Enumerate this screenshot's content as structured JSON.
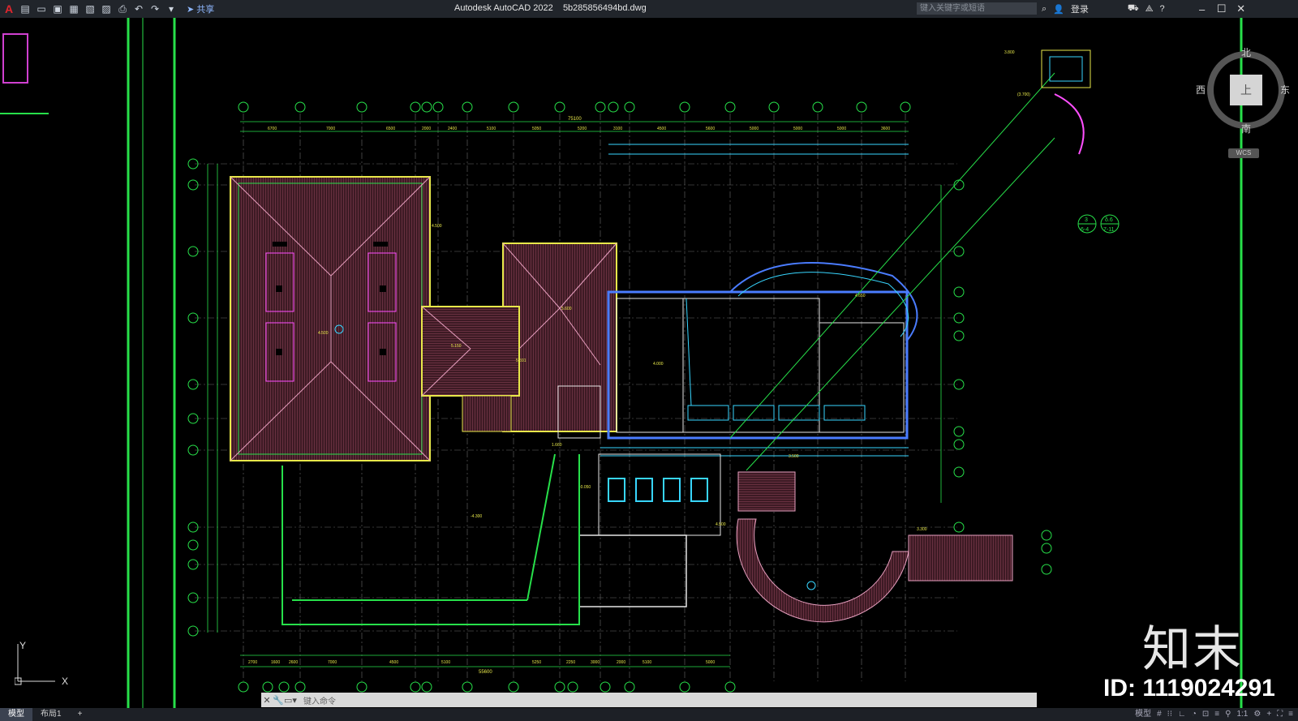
{
  "titlebar": {
    "app_name": "Autodesk AutoCAD 2022",
    "file_name": "5b285856494bd.dwg",
    "share_label": "共享",
    "search_placeholder": "键入关键字或短语",
    "login_label": "登录"
  },
  "viewcube": {
    "north": "北",
    "south": "南",
    "west": "西",
    "east": "东",
    "face": "上",
    "wcs": "WCS"
  },
  "commandline": {
    "placeholder": "键入命令"
  },
  "statusbar": {
    "tabs": [
      "模型",
      "布局1"
    ],
    "add_tab": "+",
    "right_model": "模型",
    "scale": "1:1"
  },
  "drawing": {
    "levels": [
      "4.500",
      "5.600",
      "5.150",
      "5.591",
      "4.000",
      "4.500",
      "-0.050",
      "-4.300",
      "1.660",
      "3.500",
      "4.500",
      "3.800",
      "(3.700)",
      "4.650",
      "3.300"
    ],
    "dims_top": [
      "6700",
      "7000",
      "6500",
      "2000",
      "2400",
      "5100",
      "5050",
      "5200",
      "3100",
      "4500",
      "5600",
      "5000",
      "5000",
      "5000",
      "3600"
    ],
    "total_top": "75100",
    "dims_bottom": [
      "2700",
      "1600",
      "2600",
      "7000",
      "4500",
      "5100",
      "5250",
      "2250",
      "3000",
      "2000",
      "5100",
      "5000"
    ],
    "total_bottom": "55600",
    "detail_ref": [
      "3",
      "6-4",
      "δ.6",
      "7-11"
    ],
    "ucs_x": "X",
    "ucs_y": "Y"
  },
  "watermark": {
    "brand": "知末",
    "id": "ID: 1119024291"
  },
  "colors": {
    "green": "#27e04a",
    "magenta": "#ff4fff",
    "roof_fill": "#4a1f2a",
    "cyan": "#38d6ff",
    "yellow": "#e8e84a",
    "white_line": "#e6e6e6"
  }
}
